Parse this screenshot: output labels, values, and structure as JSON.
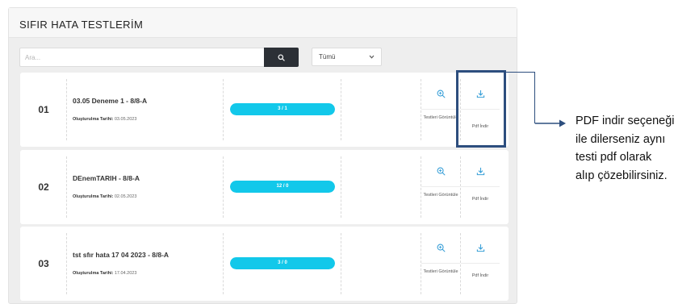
{
  "page": {
    "title": "SIFIR HATA TESTLERİM"
  },
  "search": {
    "placeholder": "Ara..."
  },
  "filter": {
    "selected": "Tümü"
  },
  "tests": [
    {
      "number": "01",
      "name": "03.05 Deneme 1 - 8/8-A",
      "date_label": "Oluşturulma Tarihi:",
      "date": "03.05.2023",
      "progress_text": "3 / 1",
      "progress_fraction": 1.0,
      "view_label": "Testleri Görüntüle",
      "pdf_label": "Pdf İndir"
    },
    {
      "number": "02",
      "name": "DEnemTARIH - 8/8-A",
      "date_label": "Oluşturulma Tarihi:",
      "date": "02.05.2023",
      "progress_text": "12 / 0",
      "progress_fraction": 1.0,
      "view_label": "Testleri Görüntüle",
      "pdf_label": "Pdf İndir"
    },
    {
      "number": "03",
      "name": "tst sfır hata 17 04 2023 - 8/8-A",
      "date_label": "Oluşturulma Tarihi:",
      "date": "17.04.2023",
      "progress_text": "3 / 0",
      "progress_fraction": 1.0,
      "view_label": "Testleri Görüntüle",
      "pdf_label": "Pdf İndir"
    }
  ],
  "callout": {
    "lines": [
      "PDF indir seçeneği",
      "ile dilerseniz aynı",
      "testi pdf olarak",
      "alıp çözebilirsiniz."
    ]
  },
  "colors": {
    "accent": "#12c8ea",
    "search_button": "#2c3036",
    "highlight": "#2d4e7e",
    "icon": "#3aa0d8"
  },
  "icons": {
    "search": "search-icon",
    "view": "zoom-in-icon",
    "download": "download-icon",
    "chevron": "chevron-down-icon"
  }
}
